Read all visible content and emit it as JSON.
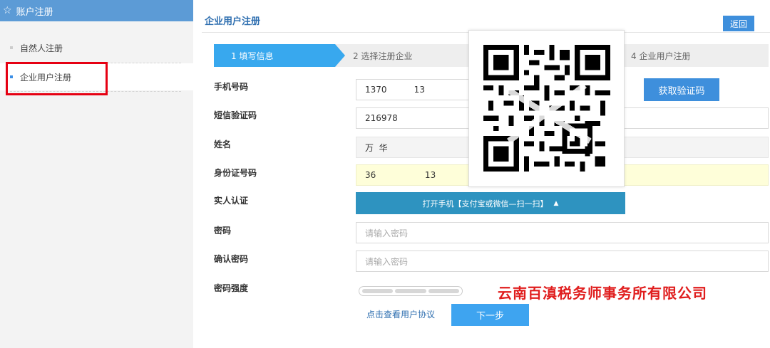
{
  "sidebar": {
    "header": "账户注册",
    "items": [
      {
        "label": "自然人注册"
      },
      {
        "label": "企业用户注册"
      }
    ]
  },
  "header": {
    "title": "企业用户注册",
    "back_label": "返回"
  },
  "steps": [
    {
      "label": "1 填写信息"
    },
    {
      "label": "2 选择注册企业"
    },
    {
      "label": "4 企业用户注册"
    }
  ],
  "form": {
    "phone": {
      "label": "手机号码",
      "value": "1370          13"
    },
    "get_code_label": "获取验证码",
    "sms_code": {
      "label": "短信验证码",
      "value": "216978"
    },
    "name": {
      "label": "姓名",
      "value": "万  华"
    },
    "id_card": {
      "label": "身份证号码",
      "value": "36                  13"
    },
    "real_name": {
      "label": "实人认证",
      "button_label": "打开手机【支付宝或微信—扫一扫】"
    },
    "password": {
      "label": "密码",
      "placeholder": "请输入密码"
    },
    "confirm_password": {
      "label": "确认密码",
      "placeholder": "请输入密码"
    },
    "strength": {
      "label": "密码强度"
    }
  },
  "footer": {
    "agreement_link": "点击查看用户协议",
    "next_label": "下一步"
  },
  "watermark": "云南百滇税务师事务所有限公司",
  "colors": {
    "sidebar_header": "#5c9bd6",
    "primary_button": "#3e8fdc",
    "step_active": "#38a8ee",
    "verify_button": "#2e93c0",
    "highlight": "#e60012",
    "watermark": "#e01d1d"
  }
}
